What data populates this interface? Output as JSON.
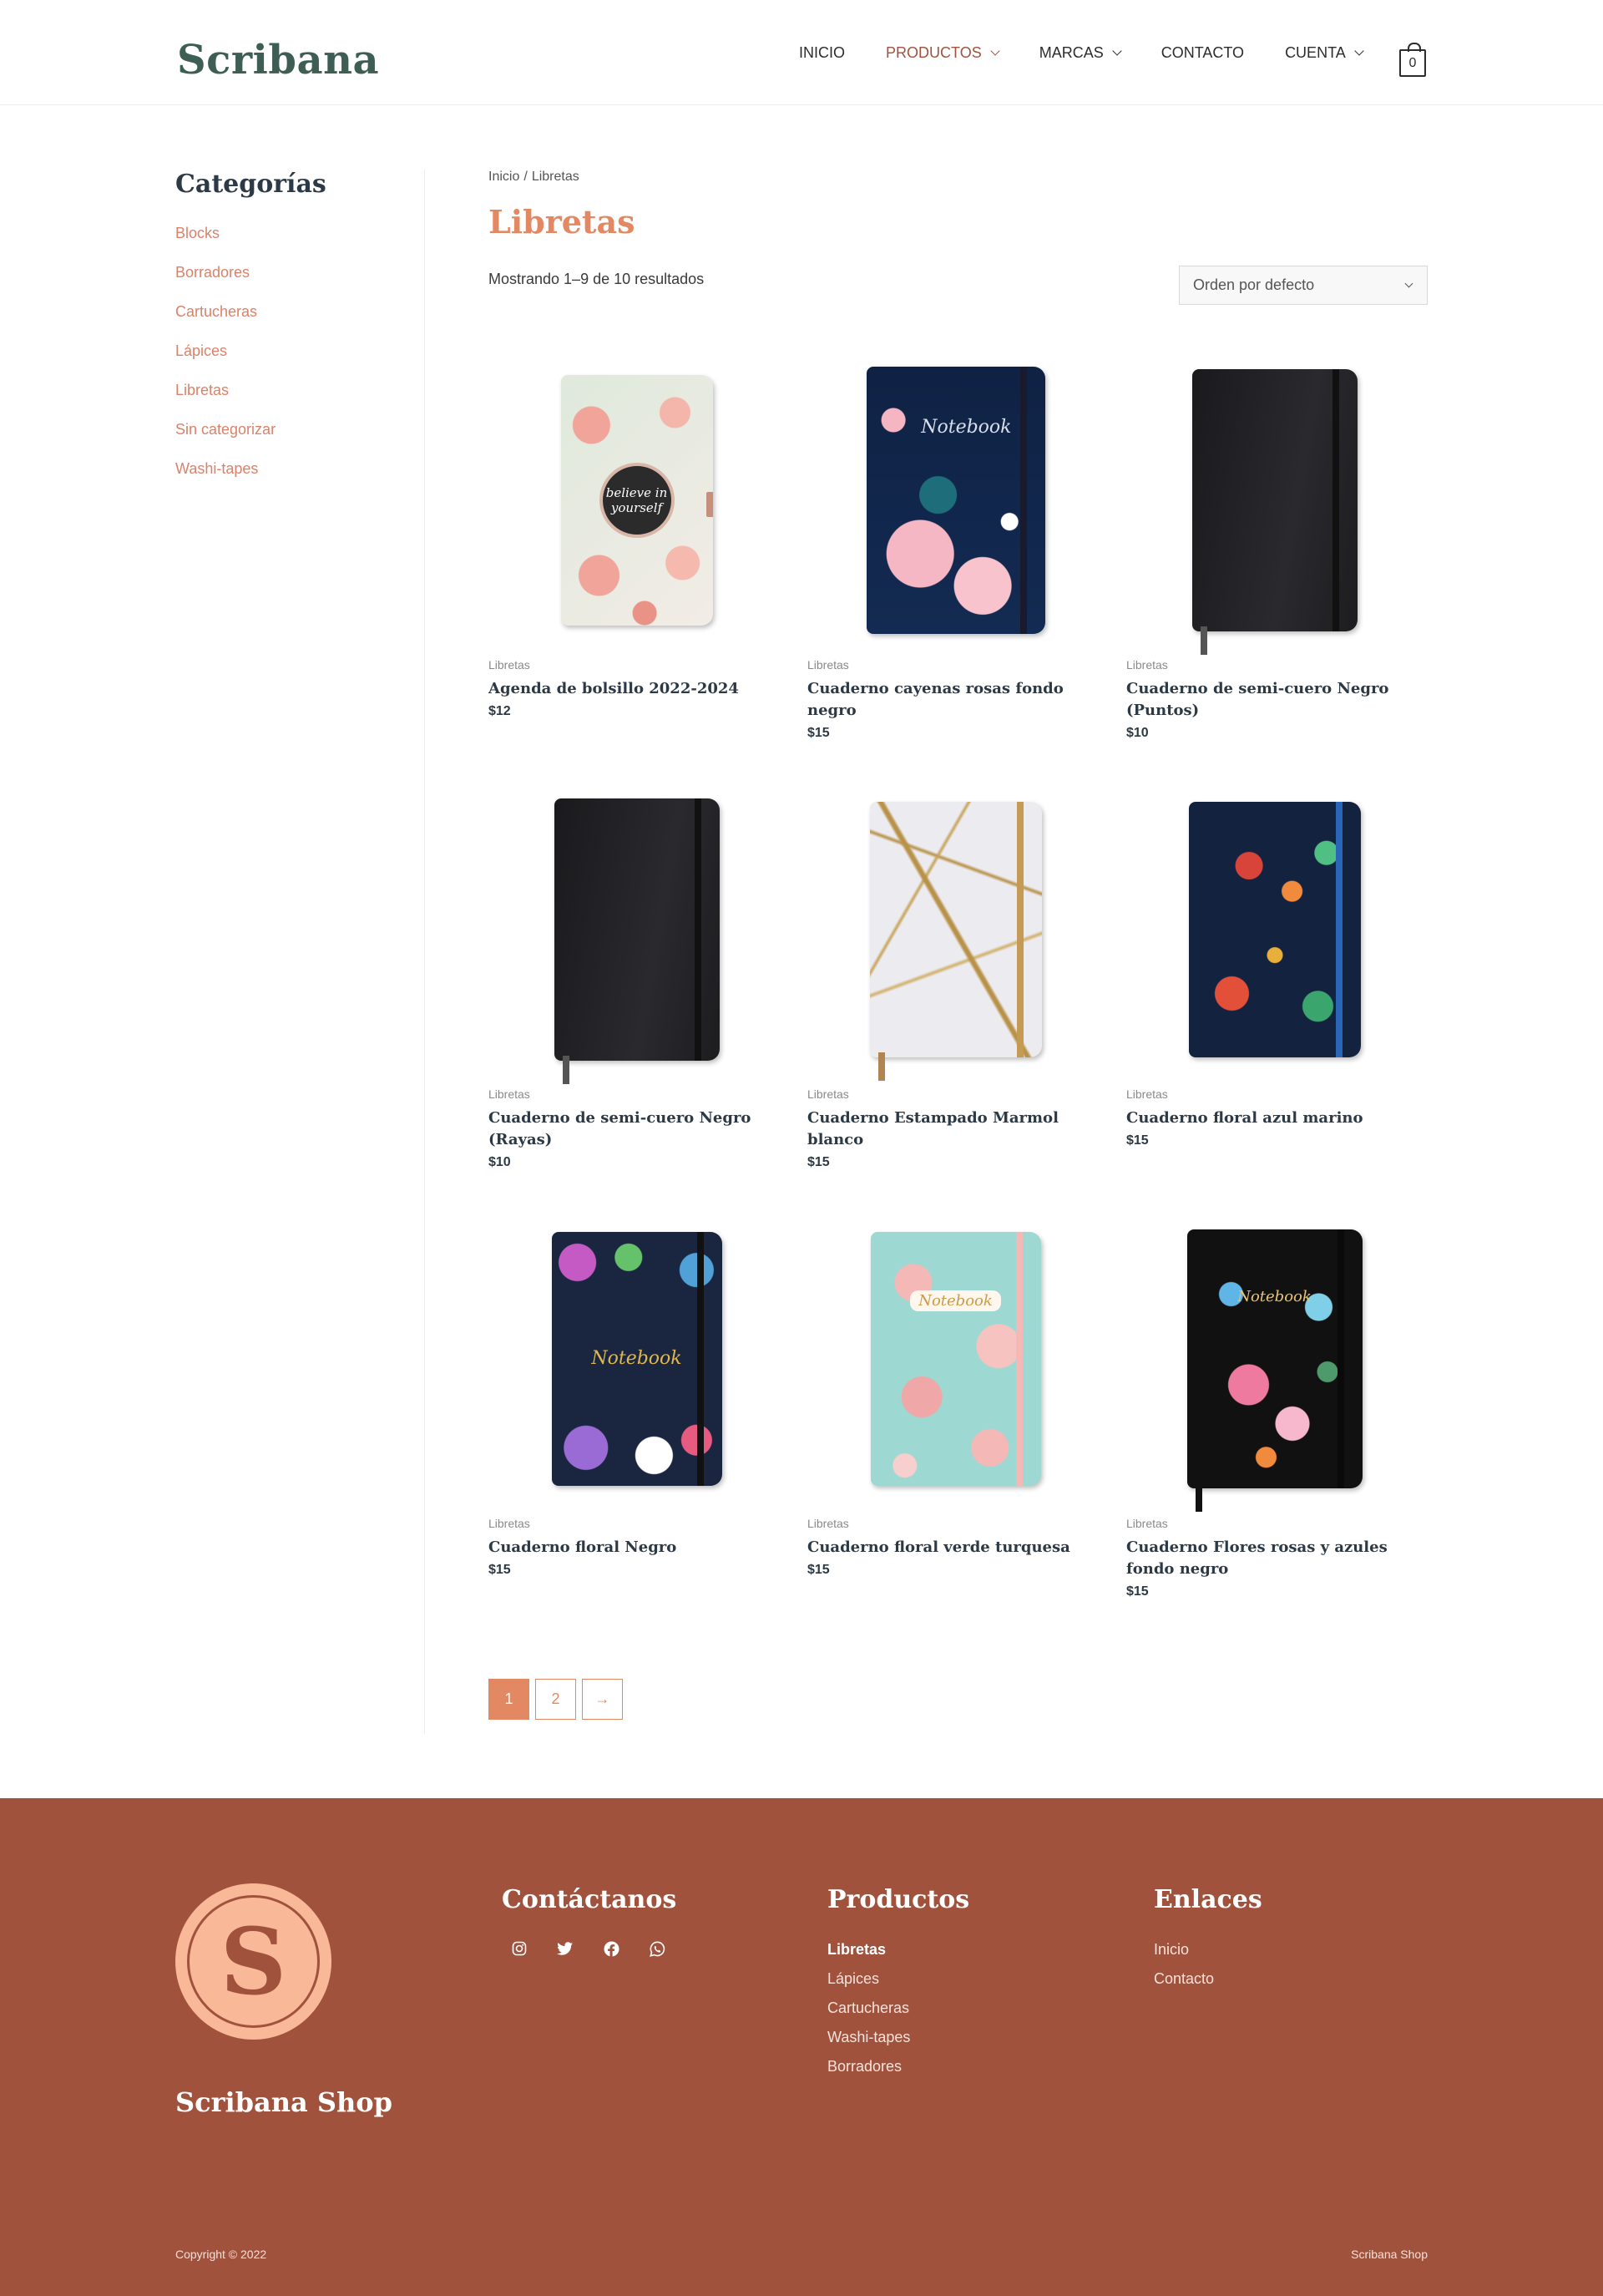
{
  "header": {
    "logo": "Scribana",
    "nav": [
      {
        "label": "INICIO"
      },
      {
        "label": "PRODUCTOS"
      },
      {
        "label": "MARCAS"
      },
      {
        "label": "CONTACTO"
      },
      {
        "label": "CUENTA"
      }
    ],
    "cart_count": "0",
    "active_color": "#a0523d"
  },
  "sidebar": {
    "title": "Categorías",
    "categories": [
      "Blocks",
      "Borradores",
      "Cartucheras",
      "Lápices",
      "Libretas",
      "Sin categorizar",
      "Washi-tapes"
    ]
  },
  "main": {
    "breadcrumb": {
      "home": "Inicio",
      "separator": "/",
      "current": "Libretas"
    },
    "title": "Libretas",
    "result_count": "Mostrando 1–9 de 10 resultados",
    "orderby": "Orden por defecto",
    "products": [
      {
        "category": "Libretas",
        "title": "Agenda de bolsillo 2022-2024",
        "price": "$12",
        "cover_text": "believe in yourself"
      },
      {
        "category": "Libretas",
        "title": "Cuaderno cayenas rosas fondo negro",
        "price": "$15",
        "cover_text": "Notebook"
      },
      {
        "category": "Libretas",
        "title": "Cuaderno de semi-cuero Negro (Puntos)",
        "price": "$10",
        "cover_text": ""
      },
      {
        "category": "Libretas",
        "title": "Cuaderno de semi-cuero Negro (Rayas)",
        "price": "$10",
        "cover_text": ""
      },
      {
        "category": "Libretas",
        "title": "Cuaderno Estampado Marmol blanco",
        "price": "$15",
        "cover_text": ""
      },
      {
        "category": "Libretas",
        "title": "Cuaderno floral azul marino",
        "price": "$15",
        "cover_text": ""
      },
      {
        "category": "Libretas",
        "title": "Cuaderno floral Negro",
        "price": "$15",
        "cover_text": "Notebook"
      },
      {
        "category": "Libretas",
        "title": "Cuaderno floral verde turquesa",
        "price": "$15",
        "cover_text": "Notebook"
      },
      {
        "category": "Libretas",
        "title": "Cuaderno Flores rosas y azules fondo negro",
        "price": "$15",
        "cover_text": "Notebook"
      }
    ],
    "pagination": [
      "1",
      "2",
      "→"
    ]
  },
  "footer": {
    "shop_name": "Scribana Shop",
    "logo_letter": "S",
    "contact_title": "Contáctanos",
    "social_icons": [
      "instagram-icon",
      "twitter-icon",
      "facebook-icon",
      "whatsapp-icon"
    ],
    "products_title": "Productos",
    "products_links": [
      "Libretas",
      "Lápices",
      "Cartucheras",
      "Washi-tapes",
      "Borradores"
    ],
    "links_title": "Enlaces",
    "links": [
      "Inicio",
      "Contacto"
    ],
    "copyright": "Copyright © 2022",
    "right_text": "Scribana Shop",
    "bg_color": "#a0523d",
    "accent_color": "#e28963"
  }
}
